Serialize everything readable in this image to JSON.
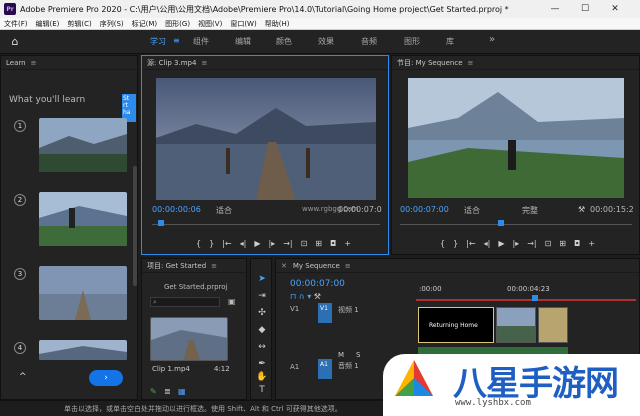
{
  "titlebar": {
    "logo": "Pr",
    "title": "Adobe Premiere Pro 2020 - C:\\用户\\公用\\公用文档\\Adobe\\Premiere Pro\\14.0\\Tutorial\\Going Home project\\Get Started.prproj *",
    "minimize": "—",
    "maximize": "☐",
    "close": "✕"
  },
  "menubar": [
    "文件(F)",
    "编辑(E)",
    "剪辑(C)",
    "序列(S)",
    "标记(M)",
    "图形(G)",
    "视图(V)",
    "窗口(W)",
    "帮助(H)"
  ],
  "workspaces": {
    "home_icon": "home-icon",
    "items": [
      "学习",
      "组件",
      "编辑",
      "颜色",
      "效果",
      "音频",
      "图形",
      "库"
    ],
    "active": "学习",
    "more": "»"
  },
  "learn": {
    "title": "Learn",
    "heading": "What you'll learn",
    "steps": [
      "1",
      "2",
      "3",
      "4"
    ],
    "chip": "St rt ha",
    "up_icon": "^",
    "next_icon": "›"
  },
  "source": {
    "title": "源: Clip 3.mp4",
    "timecode": "00:00:00:06",
    "fit": "适合",
    "quality": "1/2",
    "duration": "00:00:07:0",
    "watermark_url": "www.rgbgg.com"
  },
  "program": {
    "title": "节目: My Sequence",
    "timecode": "00:00:07:00",
    "fit": "适合",
    "quality": "完整",
    "duration": "00:00:15:2"
  },
  "project": {
    "title": "项目: Get Started",
    "file": "Get Started.prproj",
    "clip_name": "Clip 1.mp4",
    "clip_duration": "4:12"
  },
  "timeline": {
    "title": "My Sequence",
    "timecode": "00:00:07:00",
    "ruler_labels": [
      ":00:00",
      "00:00:04:23"
    ],
    "v1_label": "视频 1",
    "a1_label": "音频 1",
    "v1": "V1",
    "a1": "A1",
    "clip_title": "Returning Home"
  },
  "status": "单击以选择，或单击空白处并拖动以进行框选。使用 Shift、Alt 和 Ctrl 可获得其他选项。",
  "watermark": {
    "text": "八星手游网",
    "url": "www.lyshbx.com"
  },
  "colors": {
    "accent": "#2d8ceb",
    "bg": "#232323"
  }
}
